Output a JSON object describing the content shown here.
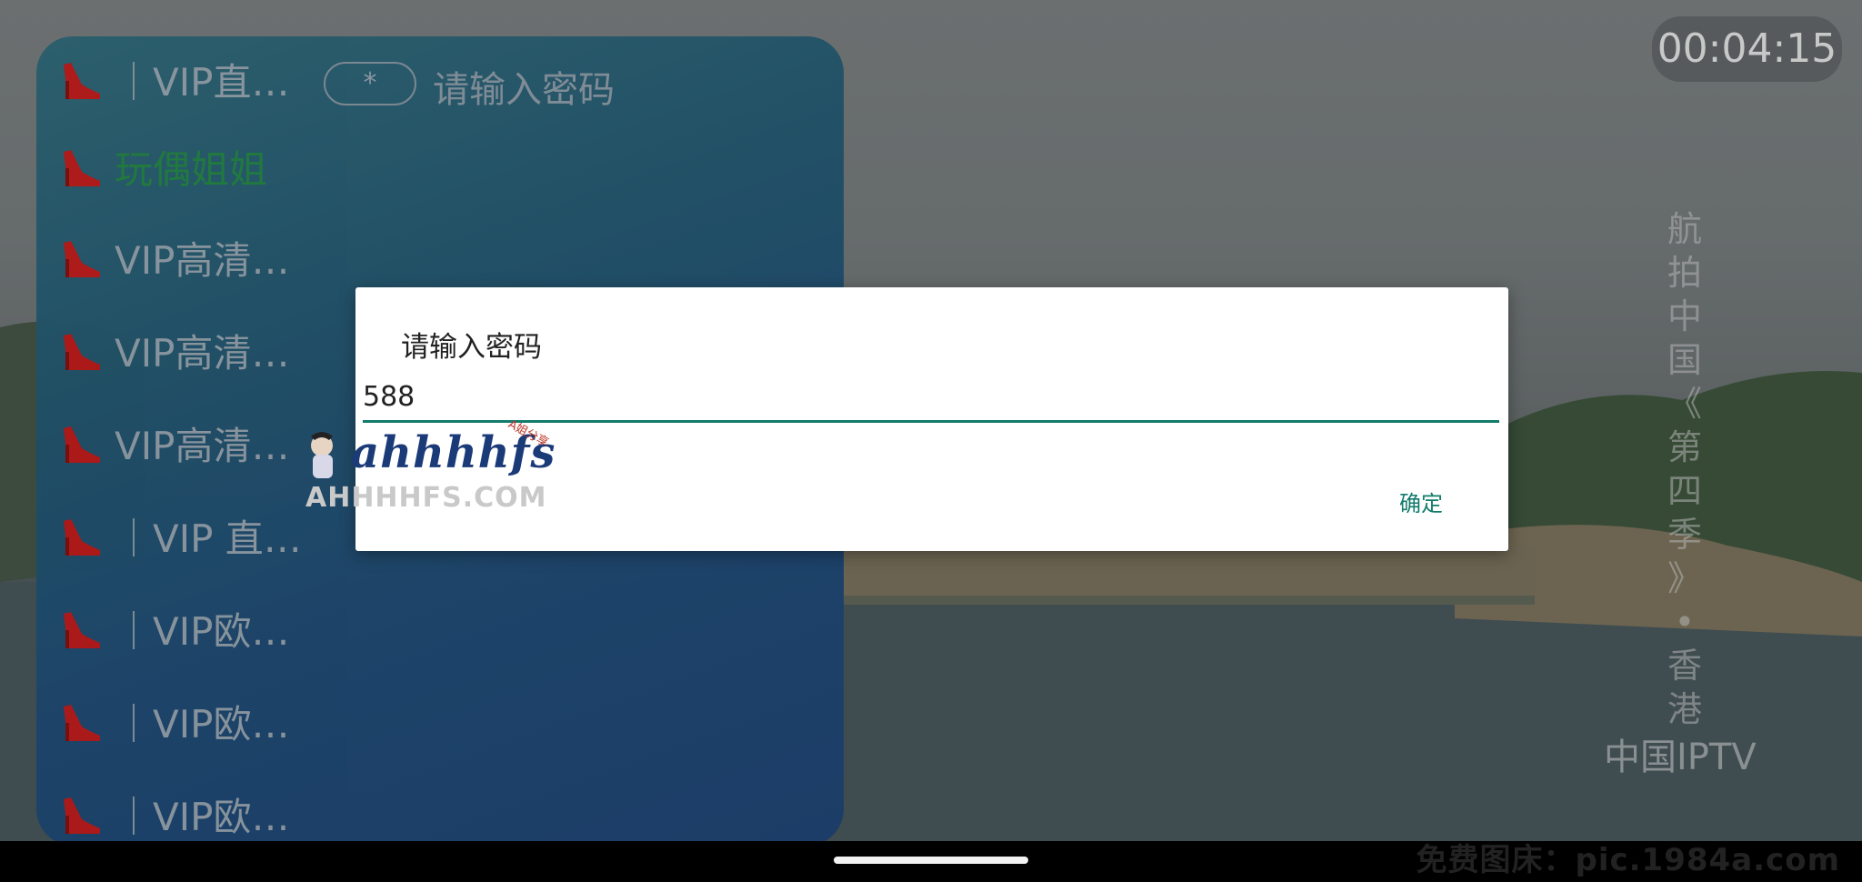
{
  "clock": "00:04:15",
  "vertical_caption": [
    "航",
    "拍",
    "中",
    "国",
    "《",
    "第",
    "四",
    "季",
    "》",
    "•",
    "香",
    "港"
  ],
  "channel_logo": "中国IPTV",
  "password_bar": {
    "pill": "*",
    "hint": "请输入密码"
  },
  "channels": [
    {
      "label": "｜VIP直…",
      "active": false
    },
    {
      "label": "玩偶姐姐",
      "active": true
    },
    {
      "label": "VIP高清…",
      "active": false
    },
    {
      "label": "VIP高清…",
      "active": false
    },
    {
      "label": "VIP高清…",
      "active": false
    },
    {
      "label": "｜VIP 直…",
      "active": false
    },
    {
      "label": "｜VIP欧…",
      "active": false
    },
    {
      "label": "｜VIP欧…",
      "active": false
    },
    {
      "label": "｜VIP欧…",
      "active": false
    }
  ],
  "dialog": {
    "title": "请输入密码",
    "input_value": "588",
    "ok_label": "确定"
  },
  "site_logo": {
    "text": "ahhhhfs",
    "tag": "A姐分享",
    "sub": "AHHHHFS.COM"
  },
  "bottom_watermark": "免费图床：pic.1984a.com",
  "colors": {
    "accent": "#137c6c",
    "active_channel": "#1f7a3e"
  },
  "icons": {
    "channel_icon": "red-high-heel-icon"
  }
}
